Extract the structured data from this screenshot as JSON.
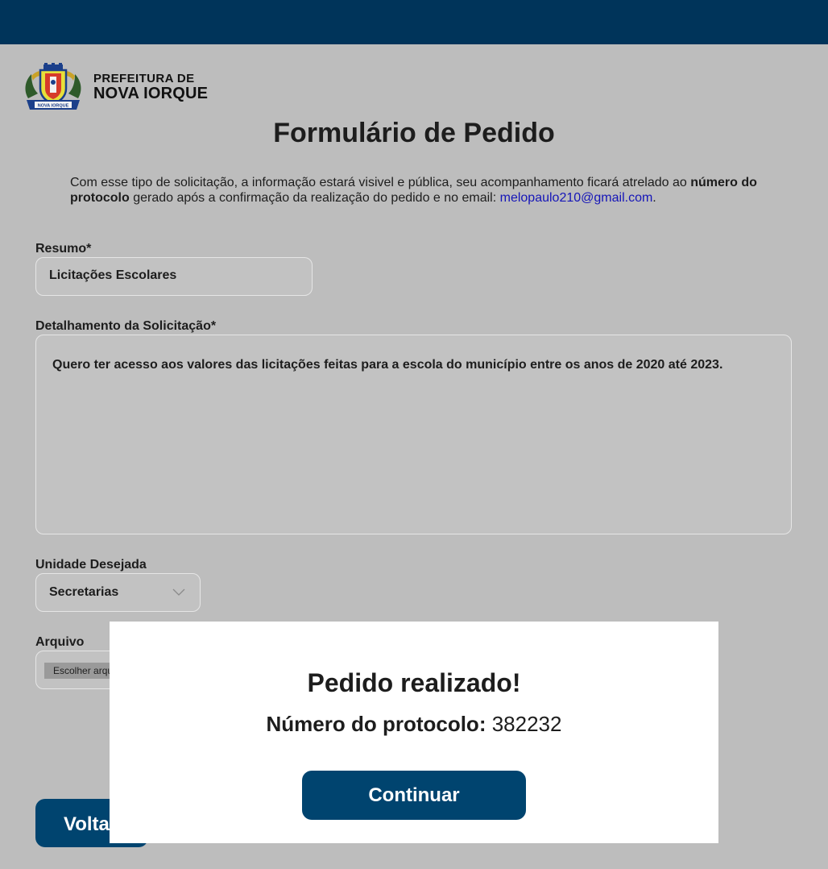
{
  "brand": {
    "line1": "PREFEITURA DE",
    "line2": "NOVA IORQUE",
    "crest_ribbon": "NOVA IORQUE"
  },
  "page": {
    "title": "Formulário de Pedido"
  },
  "intro": {
    "text_before": "Com esse tipo de solicitação, a informação estará visivel e pública, seu acompanhamento ficará atrelado ao ",
    "bold": "número do protocolo",
    "text_middle": " gerado após a confirmação da realização do pedido e no email: ",
    "email": "melopaulo210@gmail.com",
    "text_end": "."
  },
  "form": {
    "resumo_label": "Resumo*",
    "resumo_value": "Licitações Escolares",
    "detalhe_label": "Detalhamento da Solicitação*",
    "detalhe_value": "Quero ter acesso aos valores das licitações feitas para a escola do município entre os anos de 2020 até 2023.",
    "unidade_label": "Unidade Desejada",
    "unidade_value": "Secretarias",
    "arquivo_label": "Arquivo",
    "arquivo_button": "Escolher arquivo"
  },
  "actions": {
    "voltar_label": "Voltar"
  },
  "modal": {
    "title": "Pedido realizado!",
    "protocol_label": "Número do protocolo:",
    "protocol_number": "382232",
    "continue_label": "Continuar"
  },
  "colors": {
    "topbar": "#00345a",
    "background": "#bdbdbd",
    "button": "#00446f",
    "email_link": "#1515b8"
  },
  "icons": {
    "crest": "city-crest-icon",
    "select_arrow": "chevron-down-icon"
  }
}
